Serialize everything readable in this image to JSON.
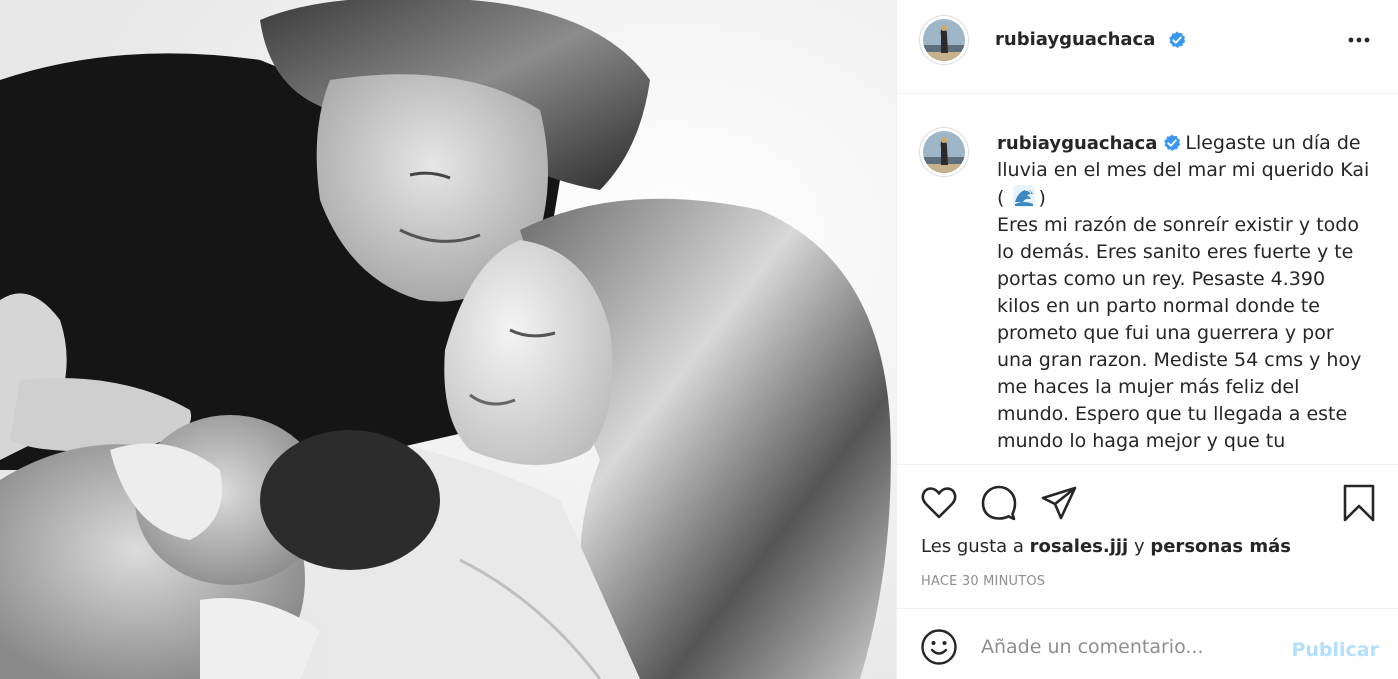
{
  "post": {
    "username": "rubiayguachaca",
    "verified": true,
    "caption_lines": [
      "Llegaste un día de",
      "lluvia en el mes del mar mi querido Kai",
      "Eres mi razón de sonreír existir y todo",
      "lo demás. Eres sanito eres fuerte y te",
      "portas como un rey. Pesaste 4.390",
      "kilos en un parto normal donde te",
      "prometo que fui una guerrera y por",
      "una gran razon. Mediste 54 cms y hoy",
      "me haces la mujer más feliz del",
      "mundo. Espero que tu llegada a este",
      "mundo lo haga mejor y que tu"
    ],
    "caption_emoji_open": "(",
    "caption_emoji_close": ")",
    "caption_emoji": "wave-emoji",
    "likes_prefix": "Les gusta a",
    "likes_user": "rosales.jjj",
    "likes_conjunction": "y",
    "likes_suffix": "personas más",
    "timestamp": "HACE 30 MINUTOS"
  },
  "comment": {
    "placeholder": "Añade un comentario...",
    "publish_label": "Publicar"
  },
  "icons": {
    "more": "more-options-icon",
    "like": "heart-icon",
    "comment": "comment-icon",
    "share": "share-icon",
    "save": "bookmark-icon",
    "emoji": "smiley-icon",
    "verified": "verified-badge-icon"
  },
  "colors": {
    "verified_blue": "#3897f0",
    "publish_disabled": "#b2dffc",
    "muted_text": "#8e8e8e",
    "primary_text": "#262626"
  }
}
